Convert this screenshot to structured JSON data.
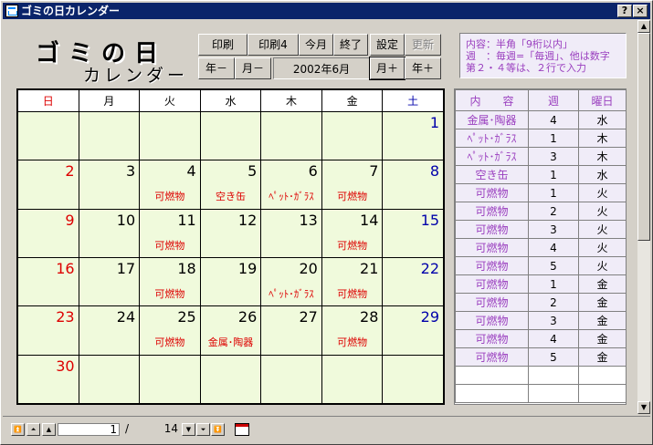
{
  "window": {
    "title": "ゴミの日カレンダー",
    "help_label": "?",
    "close_label": "×"
  },
  "logo": {
    "line1": "ゴミの日",
    "line2": "カレンダー"
  },
  "toolbar": {
    "print": "印刷",
    "print4": "印刷4",
    "this_month": "今月",
    "exit": "終了",
    "settings": "設定",
    "renew": "更新",
    "year_prev": "年－",
    "month_prev": "月－",
    "current_month": "2002年6月",
    "month_next": "月＋",
    "year_next": "年＋"
  },
  "note": {
    "line1": "内容：半角「9桁以内」",
    "line2": "週　：毎週=「毎週」、他は数字",
    "line3": "第２・４等は、２行で入力"
  },
  "calendar": {
    "weekdays": [
      "日",
      "月",
      "火",
      "水",
      "木",
      "金",
      "土"
    ],
    "weeks": [
      [
        {
          "d": "",
          "e": ""
        },
        {
          "d": "",
          "e": ""
        },
        {
          "d": "",
          "e": ""
        },
        {
          "d": "",
          "e": ""
        },
        {
          "d": "",
          "e": ""
        },
        {
          "d": "",
          "e": ""
        },
        {
          "d": "1",
          "e": ""
        }
      ],
      [
        {
          "d": "2",
          "e": ""
        },
        {
          "d": "3",
          "e": ""
        },
        {
          "d": "4",
          "e": "可燃物"
        },
        {
          "d": "5",
          "e": "空き缶"
        },
        {
          "d": "6",
          "e": "ﾍﾟｯﾄ･ｶﾞﾗｽ"
        },
        {
          "d": "7",
          "e": "可燃物"
        },
        {
          "d": "8",
          "e": ""
        }
      ],
      [
        {
          "d": "9",
          "e": ""
        },
        {
          "d": "10",
          "e": ""
        },
        {
          "d": "11",
          "e": "可燃物"
        },
        {
          "d": "12",
          "e": ""
        },
        {
          "d": "13",
          "e": ""
        },
        {
          "d": "14",
          "e": "可燃物"
        },
        {
          "d": "15",
          "e": ""
        }
      ],
      [
        {
          "d": "16",
          "e": ""
        },
        {
          "d": "17",
          "e": ""
        },
        {
          "d": "18",
          "e": "可燃物"
        },
        {
          "d": "19",
          "e": ""
        },
        {
          "d": "20",
          "e": "ﾍﾟｯﾄ･ｶﾞﾗｽ"
        },
        {
          "d": "21",
          "e": "可燃物"
        },
        {
          "d": "22",
          "e": ""
        }
      ],
      [
        {
          "d": "23",
          "e": ""
        },
        {
          "d": "24",
          "e": ""
        },
        {
          "d": "25",
          "e": "可燃物"
        },
        {
          "d": "26",
          "e": "金属･陶器"
        },
        {
          "d": "27",
          "e": ""
        },
        {
          "d": "28",
          "e": "可燃物"
        },
        {
          "d": "29",
          "e": ""
        }
      ],
      [
        {
          "d": "30",
          "e": ""
        },
        {
          "d": "",
          "e": ""
        },
        {
          "d": "",
          "e": ""
        },
        {
          "d": "",
          "e": ""
        },
        {
          "d": "",
          "e": ""
        },
        {
          "d": "",
          "e": ""
        },
        {
          "d": "",
          "e": ""
        }
      ]
    ]
  },
  "schedule": {
    "headers": [
      "内　　容",
      "週",
      "曜日"
    ],
    "rows": [
      [
        "金属･陶器",
        "4",
        "水"
      ],
      [
        "ﾍﾟｯﾄ･ｶﾞﾗｽ",
        "1",
        "木"
      ],
      [
        "ﾍﾟｯﾄ･ｶﾞﾗｽ",
        "3",
        "木"
      ],
      [
        "空き缶",
        "1",
        "水"
      ],
      [
        "可燃物",
        "1",
        "火"
      ],
      [
        "可燃物",
        "2",
        "火"
      ],
      [
        "可燃物",
        "3",
        "火"
      ],
      [
        "可燃物",
        "4",
        "火"
      ],
      [
        "可燃物",
        "5",
        "火"
      ],
      [
        "可燃物",
        "1",
        "金"
      ],
      [
        "可燃物",
        "2",
        "金"
      ],
      [
        "可燃物",
        "3",
        "金"
      ],
      [
        "可燃物",
        "4",
        "金"
      ],
      [
        "可燃物",
        "5",
        "金"
      ],
      [
        "",
        "",
        ""
      ],
      [
        "",
        "",
        ""
      ]
    ]
  },
  "record_nav": {
    "current": "1",
    "separator": "/",
    "total": "14"
  },
  "colors": {
    "calendar_bg": "#f0fadc",
    "sunday": "#dd0000",
    "saturday": "#0000aa",
    "event": "#dd0000",
    "note_text": "#9a3fbf"
  }
}
